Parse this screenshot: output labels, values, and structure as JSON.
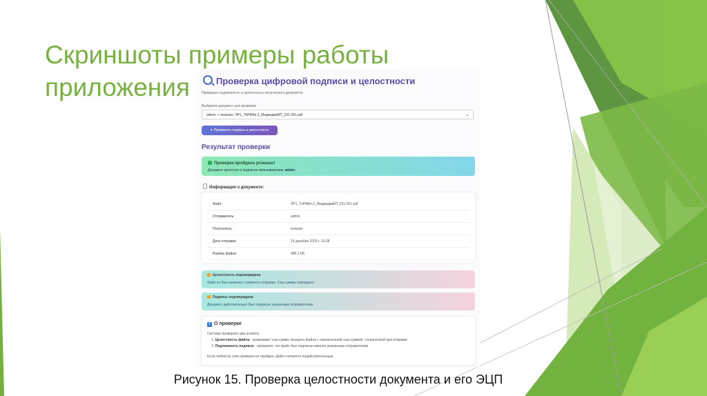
{
  "slide": {
    "title": "Скриншоты примеры работы приложения",
    "caption": "Рисунок 15. Проверка целостности документа и его ЭЦП",
    "accent_color": "#77b140"
  },
  "app": {
    "title": "Проверка цифровой подписи и целостности",
    "subtitle": "Проверьте подлинность и целостность полученного документа",
    "select_label": "Выберите документ для проверки",
    "select_value": "admin -> testuser: ЛР1_ТпРМКп.3_МедведваБП_231-351.pdf",
    "verify_button": "✦ Проверить подпись и целостность",
    "result_title": "Результат проверки",
    "success": {
      "title": "Проверка пройдена успешно!",
      "text_prefix": "Документ целостен и подписан пользователем:",
      "user": "admin"
    },
    "doc_info_title": "Информация о документе:",
    "doc_info": [
      {
        "key": "Файл:",
        "value": "ЛР1_ТпРМКп.3_МедведваБП_231-351.pdf"
      },
      {
        "key": "Отправитель:",
        "value": "admin"
      },
      {
        "key": "Получатель:",
        "value": "testuser"
      },
      {
        "key": "Дата отправки:",
        "value": "19 декабря 2025 г. 16:28"
      },
      {
        "key": "Размер файла:",
        "value": "486.1 КБ"
      }
    ],
    "integrity": {
      "title": "Целостность подтверждена",
      "text": "Файл не был изменен с момента отправки. Хэш-суммы совпадают."
    },
    "signature": {
      "title": "Подпись подтверждена",
      "text": "Документ действительно был подписан указанным отправителем."
    },
    "about": {
      "title": "О проверке",
      "intro": "Система проверяет два аспекта:",
      "item1_bold": "Целостность файла",
      "item1_text": " - сравнивает хэш-сумму текущего файла с оригинальной хэш-суммой, сохраненной при отправке",
      "item2_bold": "Подлинность подписи",
      "item2_text": " - проверяет, что файл был подписан именно указанным отправителем",
      "footer": "Если любой из этих проверок не пройден, файл считается недействительным."
    }
  }
}
